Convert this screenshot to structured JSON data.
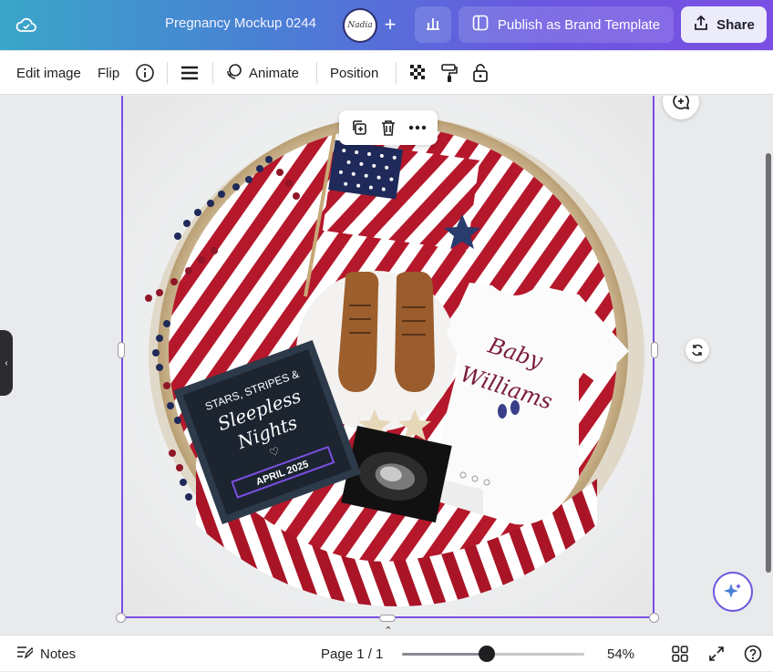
{
  "header": {
    "doc_title": "Pregnancy Mockup 0244",
    "avatar_text": "Nadia",
    "publish_label": "Publish as Brand Template",
    "share_label": "Share"
  },
  "toolbar": {
    "edit_image": "Edit image",
    "flip": "Flip",
    "animate": "Animate",
    "position": "Position"
  },
  "canvas": {
    "letterboard_line1": "STARS, STRIPES &",
    "letterboard_line2": "Sleepless",
    "letterboard_line3": "Nights",
    "letterboard_date": "APRIL 2025",
    "onesie_line1": "Baby",
    "onesie_line2": "Williams"
  },
  "footer": {
    "notes_label": "Notes",
    "page_label": "Page 1 / 1",
    "zoom_label": "54%",
    "zoom_value": 54
  },
  "colors": {
    "accent": "#7b4fe3",
    "stripe_red": "#b5182b"
  }
}
